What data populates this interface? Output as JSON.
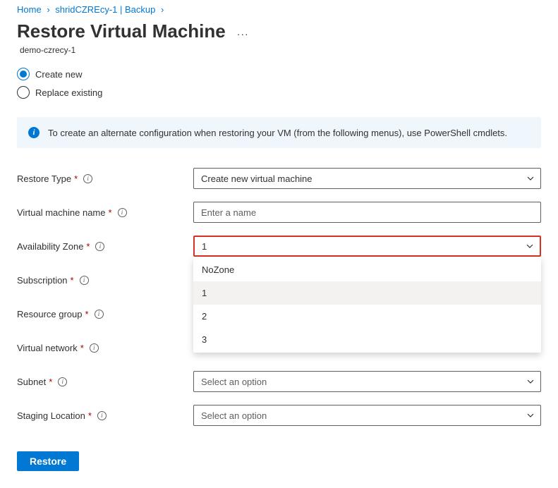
{
  "breadcrumbs": {
    "home": "Home",
    "crumb1": "shridCZREcy-1 | Backup"
  },
  "page_title": "Restore Virtual Machine",
  "subtitle": "demo-czrecy-1",
  "radios": {
    "create_new": "Create new",
    "replace_existing": "Replace existing"
  },
  "info_banner": "To create an alternate configuration when restoring your VM (from the following menus), use PowerShell cmdlets.",
  "form": {
    "restore_type": {
      "label": "Restore Type",
      "value": "Create new virtual machine"
    },
    "vm_name": {
      "label": "Virtual machine name",
      "placeholder": "Enter a name"
    },
    "az": {
      "label": "Availability Zone",
      "value": "1",
      "options": [
        "NoZone",
        "1",
        "2",
        "3"
      ]
    },
    "subscription": {
      "label": "Subscription"
    },
    "resource_group": {
      "label": "Resource group"
    },
    "vnet": {
      "label": "Virtual network"
    },
    "subnet": {
      "label": "Subnet",
      "value": "Select an option"
    },
    "staging": {
      "label": "Staging Location",
      "value": "Select an option"
    }
  },
  "buttons": {
    "restore": "Restore"
  }
}
